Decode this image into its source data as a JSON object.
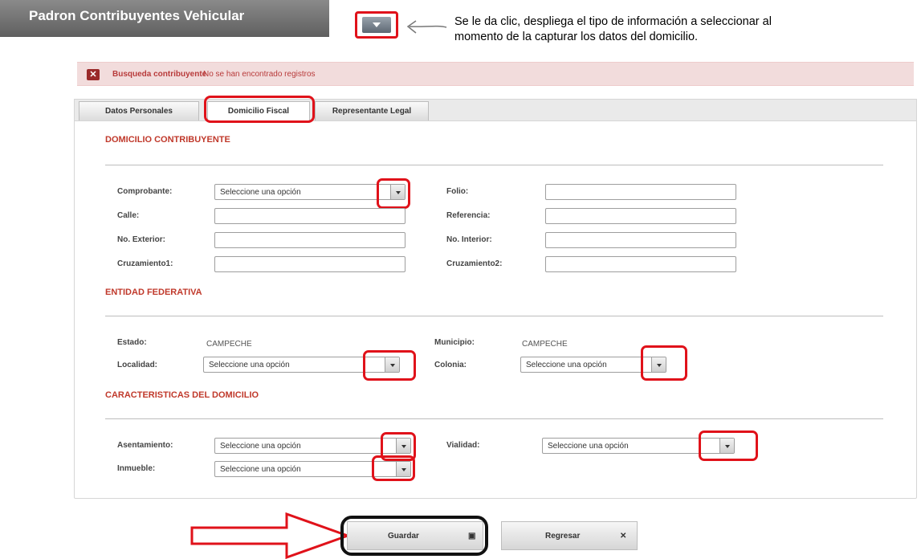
{
  "header": {
    "title": "Padron Contribuyentes Vehicular"
  },
  "note": {
    "line1": "Se le da clic, despliega el tipo de información a seleccionar al",
    "line2": "momento de la capturar los datos del domicilio."
  },
  "alert": {
    "icon": "close-icon",
    "title": "Busqueda contribuyente",
    "message": "No se han encontrado registros"
  },
  "tabs": [
    {
      "label": "Datos Personales"
    },
    {
      "label": "Domicilio Fiscal",
      "active": true
    },
    {
      "label": "Representante Legal"
    }
  ],
  "domicilio": {
    "section_title": "DOMICILIO CONTRIBUYENTE",
    "comprobante_label": "Comprobante:",
    "comprobante_value": "Seleccione una opción",
    "folio_label": "Folio:",
    "calle_label": "Calle:",
    "referencia_label": "Referencia:",
    "no_exterior_label": "No. Exterior:",
    "no_interior_label": "No. Interior:",
    "cruzamiento1_label": "Cruzamiento1:",
    "cruzamiento2_label": "Cruzamiento2:"
  },
  "entidad": {
    "section_title": "ENTIDAD FEDERATIVA",
    "estado_label": "Estado:",
    "estado_value": "CAMPECHE",
    "municipio_label": "Municipio:",
    "municipio_value": "CAMPECHE",
    "localidad_label": "Localidad:",
    "localidad_value": "Seleccione una opción",
    "colonia_label": "Colonia:",
    "colonia_value": "Seleccione una opción"
  },
  "caracteristicas": {
    "section_title": "CARACTERISTICAS DEL DOMICILIO",
    "asentamiento_label": "Asentamiento:",
    "asentamiento_value": "Seleccione una opción",
    "vialidad_label": "Vialidad:",
    "vialidad_value": "Seleccione una opción",
    "inmueble_label": "Inmueble:",
    "inmueble_value": "Seleccione una opción"
  },
  "buttons": {
    "guardar_label": "Guardar",
    "guardar_icon": "save-icon",
    "regresar_label": "Regresar",
    "regresar_icon": "close-icon"
  },
  "colors": {
    "annotation_red": "#e0121a",
    "section_title": "#c0392b",
    "alert_bg": "#f2dcdc",
    "header_bg": "#6e6e6e"
  }
}
